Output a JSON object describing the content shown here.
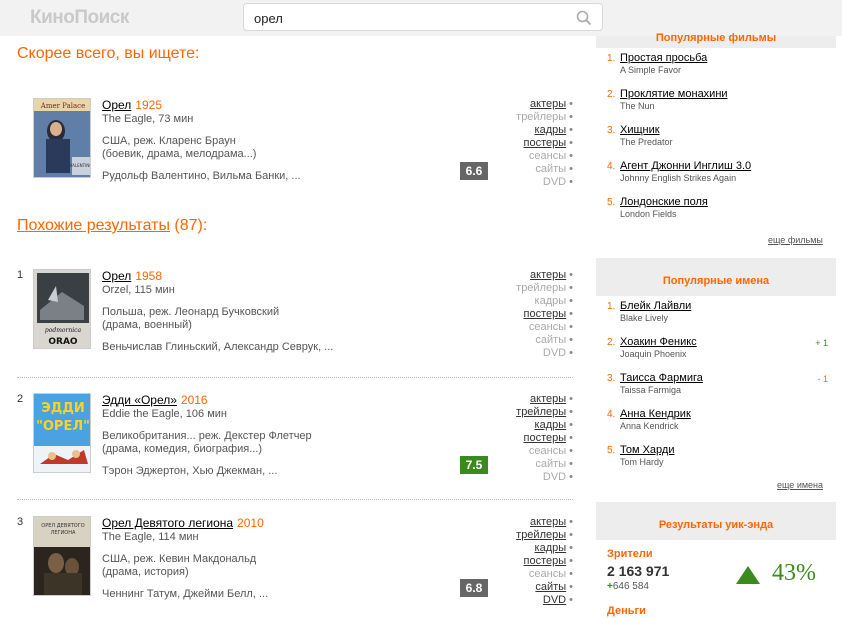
{
  "header": {
    "logo": "КиноПоиск",
    "search_value": "орел"
  },
  "main": {
    "best_heading": "Скорее всего, вы ищете:",
    "similar_heading_link": "Похожие результаты",
    "similar_count": "(87):",
    "best": {
      "title": "Орел",
      "year": "1925",
      "sub": "The Eagle, 73 мин",
      "country": "США, реж. Кларенс Браун",
      "genre": "(боевик, драма, мелодрама...)",
      "cast": "Рудольф Валентино, Вильма Банки, ...",
      "rating": "6.6",
      "rating_color": "#666666",
      "links": [
        {
          "label": "актеры",
          "active": true
        },
        {
          "label": "трейлеры",
          "active": false
        },
        {
          "label": "кадры",
          "active": true
        },
        {
          "label": "постеры",
          "active": true
        },
        {
          "label": "сеансы",
          "active": false
        },
        {
          "label": "сайты",
          "active": false
        },
        {
          "label": "DVD",
          "active": false
        }
      ]
    },
    "results": [
      {
        "num": "1",
        "title": "Орел",
        "year": "1958",
        "sub": "Orzel, 115 мин",
        "country": "Польша, реж. Леонард Бучковский",
        "genre": "(драма, военный)",
        "cast": "Веньчислав Глиньский, Александр Севрук, ...",
        "rating": "",
        "links": [
          {
            "label": "актеры",
            "active": true
          },
          {
            "label": "трейлеры",
            "active": false
          },
          {
            "label": "кадры",
            "active": false
          },
          {
            "label": "постеры",
            "active": true
          },
          {
            "label": "сеансы",
            "active": false
          },
          {
            "label": "сайты",
            "active": false
          },
          {
            "label": "DVD",
            "active": false
          }
        ]
      },
      {
        "num": "2",
        "title": "Эдди «Орел»",
        "year": "2016",
        "sub": "Eddie the Eagle, 106 мин",
        "country": "Великобритания... реж. Декстер Флетчер",
        "genre": "(драма, комедия, биография...)",
        "cast": "Тэрон Эджертон, Хью Джекман, ...",
        "rating": "7.5",
        "rating_color": "#3b8a1e",
        "links": [
          {
            "label": "актеры",
            "active": true
          },
          {
            "label": "трейлеры",
            "active": true
          },
          {
            "label": "кадры",
            "active": true
          },
          {
            "label": "постеры",
            "active": true
          },
          {
            "label": "сеансы",
            "active": false
          },
          {
            "label": "сайты",
            "active": false
          },
          {
            "label": "DVD",
            "active": false
          }
        ]
      },
      {
        "num": "3",
        "title": "Орел Девятого легиона",
        "year": "2010",
        "sub": "The Eagle, 114 мин",
        "country": "США, реж. Кевин Макдональд",
        "genre": "(драма, история)",
        "cast": "Ченнинг Татум, Джейми Белл, ...",
        "rating": "6.8",
        "rating_color": "#666666",
        "links": [
          {
            "label": "актеры",
            "active": true
          },
          {
            "label": "трейлеры",
            "active": true
          },
          {
            "label": "кадры",
            "active": true
          },
          {
            "label": "постеры",
            "active": true
          },
          {
            "label": "сеансы",
            "active": false
          },
          {
            "label": "сайты",
            "active": true
          },
          {
            "label": "DVD",
            "active": true
          }
        ]
      }
    ]
  },
  "sidebar": {
    "films": {
      "heading": "Популярные фильмы",
      "more": "еще фильмы",
      "items": [
        {
          "n": "1.",
          "title": "Простая просьба",
          "orig": "A Simple Favor"
        },
        {
          "n": "2.",
          "title": "Проклятие монахини",
          "orig": "The Nun"
        },
        {
          "n": "3.",
          "title": "Хищник",
          "orig": "The Predator"
        },
        {
          "n": "4.",
          "title": "Агент Джонни Инглиш 3.0",
          "orig": "Johnny English Strikes Again"
        },
        {
          "n": "5.",
          "title": "Лондонские поля",
          "orig": "London Fields"
        }
      ]
    },
    "names": {
      "heading": "Популярные имена",
      "more": "еще имена",
      "items": [
        {
          "n": "1.",
          "title": "Блейк Лайвли",
          "orig": "Blake Lively",
          "delta": "",
          "delta_color": ""
        },
        {
          "n": "2.",
          "title": "Хоакин Феникс",
          "orig": "Joaquin Phoenix",
          "delta": "+ 1",
          "delta_color": "#3b8a1e"
        },
        {
          "n": "3.",
          "title": "Таисса Фармига",
          "orig": "Taissa Farmiga",
          "delta": "- 1",
          "delta_color": "#f60"
        },
        {
          "n": "4.",
          "title": "Анна Кендрик",
          "orig": "Anna Kendrick",
          "delta": "",
          "delta_color": ""
        },
        {
          "n": "5.",
          "title": "Том Харди",
          "orig": "Tom Hardy",
          "delta": "",
          "delta_color": ""
        }
      ]
    },
    "weekend": {
      "heading": "Результаты уик-энда",
      "viewers_label": "Зрители",
      "viewers_value": "2 163 971",
      "viewers_delta": "646 584",
      "percent": "43%",
      "money_label": "Деньги"
    }
  }
}
